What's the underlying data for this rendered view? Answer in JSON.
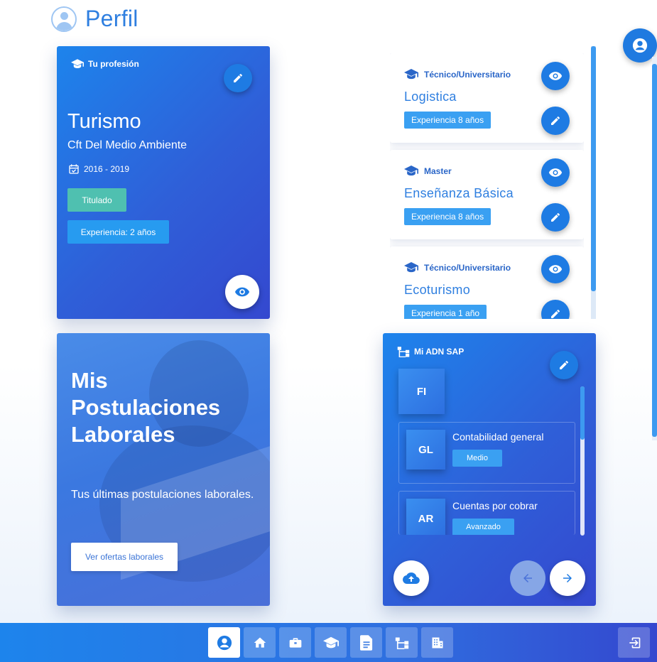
{
  "header": {
    "title": "Perfil"
  },
  "profession": {
    "tag": "Tu profesión",
    "title": "Turismo",
    "institution": "Cft Del Medio Ambiente",
    "dates": "2016 - 2019",
    "status": "Titulado",
    "experience": "Experiencia: 2 años"
  },
  "studies": [
    {
      "type": "Técnico/Universitario",
      "name": "Logistica",
      "experience": "Experiencia 8 años"
    },
    {
      "type": "Master",
      "name": "Enseñanza Básica",
      "experience": "Experiencia 8 años"
    },
    {
      "type": "Técnico/Universitario",
      "name": "Ecoturismo",
      "experience": "Experiencia 1 año"
    }
  ],
  "applications": {
    "title": "Mis Postulaciones Laborales",
    "subtitle": "Tus últimas postulaciones laborales.",
    "button_label": "Ver ofertas laborales"
  },
  "sap": {
    "tag": "Mi ADN SAP",
    "module": "FI",
    "submodules": [
      {
        "code": "GL",
        "name": "Contabilidad general",
        "level": "Medio"
      },
      {
        "code": "AR",
        "name": "Cuentas por cobrar",
        "level": "Avanzado"
      }
    ]
  },
  "nav": [
    "user-icon",
    "home-icon",
    "briefcase-icon",
    "graduation-cap-icon",
    "document-icon",
    "sitemap-icon",
    "building-icon",
    "logout-icon"
  ],
  "colors": {
    "primary": "#1e7be3",
    "accent": "#3aa0f2",
    "success": "#4fc0b0",
    "title": "#2f7fe0"
  }
}
